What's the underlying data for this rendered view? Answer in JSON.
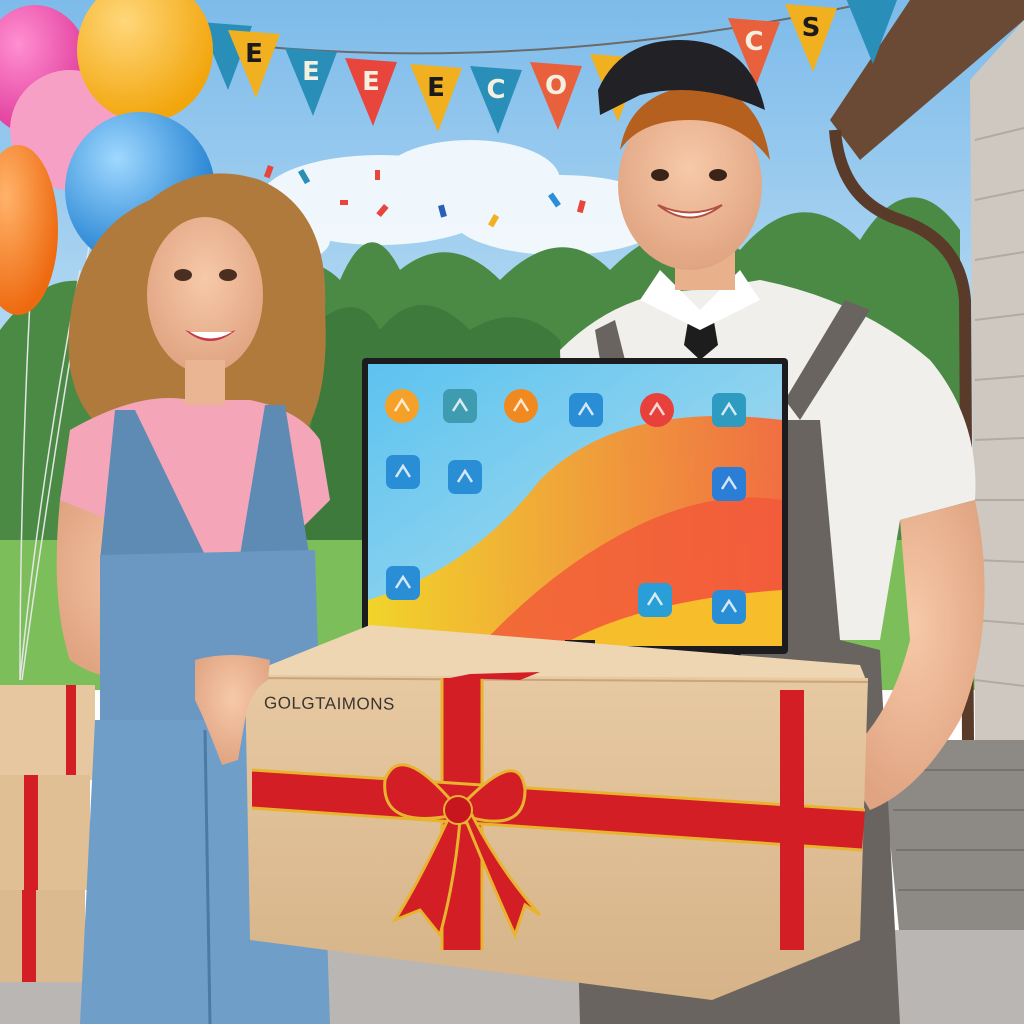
{
  "scene": {
    "banner": {
      "letters": [
        "E",
        "E",
        "E",
        "E",
        "C",
        "O",
        "C",
        "C",
        "S"
      ],
      "flag_colors": [
        "#2a8fb8",
        "#f0b020",
        "#2a8fb8",
        "#e8453c",
        "#f0b020",
        "#2a8fb8",
        "#e8603c",
        "#f0b020",
        "#e8603c",
        "#f0b020",
        "#2a8fb8"
      ]
    },
    "box": {
      "printed_text": "GOLGTAIMONS"
    },
    "tv_screen": {
      "icons": [
        "orange-circle-icon",
        "teal-square-icon",
        "orange-ball-icon",
        "blue-tile-icon",
        "red-ball-icon",
        "teal-tile-icon",
        "blue-tile-icon",
        "blue-tile-icon",
        "blue-tile-icon",
        "blue-tile-icon",
        "blue-tile-icon",
        "blue-tile-icon"
      ]
    },
    "colors": {
      "sky": "#8ec7ee",
      "trees": "#4f8a45",
      "cardboard": "#e0c19a",
      "ribbon": "#d41e26",
      "ribbon_edge": "#e8b430",
      "tv_bezel": "#1c1c1e",
      "screen_blue": "#6cc6ee",
      "screen_orange": "#f07a3c"
    }
  }
}
